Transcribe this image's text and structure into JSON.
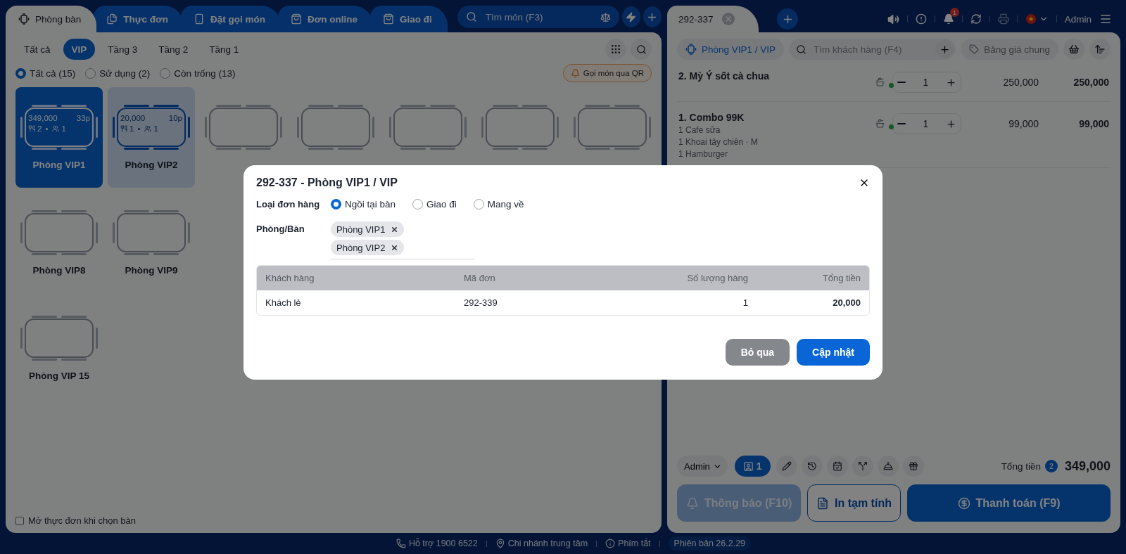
{
  "left_tabs": [
    {
      "label": "Phòng bàn",
      "selected": true
    },
    {
      "label": "Thực đơn",
      "selected": false
    },
    {
      "label": "Đặt gọi món",
      "selected": false
    },
    {
      "label": "Đơn online",
      "selected": false
    },
    {
      "label": "Giao đi",
      "selected": false
    }
  ],
  "dish_search": {
    "placeholder": "Tìm món (F3)"
  },
  "area_filters": [
    {
      "label": "Tất cả",
      "selected": false
    },
    {
      "label": "VIP",
      "selected": true
    },
    {
      "label": "Tầng 3",
      "selected": false
    },
    {
      "label": "Tầng 2",
      "selected": false
    },
    {
      "label": "Tầng 1",
      "selected": false
    }
  ],
  "status_filters": [
    {
      "label": "Tất cả (15)",
      "selected": true
    },
    {
      "label": "Sử dụng (2)",
      "selected": false
    },
    {
      "label": "Còn trống (13)",
      "selected": false
    }
  ],
  "qr_button": "Gọi món qua QR",
  "table_rows": [
    [
      {
        "label": "Phòng VIP1",
        "selected": true,
        "occupied": true,
        "amount": "349,000",
        "duration": "33p",
        "dishes": "2",
        "guests": "1"
      },
      {
        "label": "Phòng VIP2",
        "selected": false,
        "occupied": true,
        "amount": "20,000",
        "duration": "10p",
        "dishes": "1",
        "guests": "1"
      },
      {
        "selected": false,
        "occupied": false
      },
      {
        "selected": false,
        "occupied": false
      },
      {
        "selected": false,
        "occupied": false
      },
      {
        "selected": false,
        "occupied": false
      },
      {
        "selected": false,
        "occupied": false
      }
    ],
    [
      {
        "label": "Phòng VIP8",
        "selected": false,
        "occupied": false
      },
      {
        "label": "Phòng VIP9",
        "selected": false,
        "occupied": false
      }
    ],
    [
      {
        "label": "Phòng VIP 15",
        "selected": false,
        "occupied": false
      }
    ]
  ],
  "open_menu_option": {
    "label": "Mở thực đơn khi chọn bàn",
    "checked": false
  },
  "order": {
    "tab": "292-337",
    "location": "Phòng VIP1 / VIP",
    "customer_search": {
      "placeholder": "Tìm khách hàng (F4)"
    },
    "price_list": "Bảng giá chung",
    "items": [
      {
        "name": "2. Mỳ Ý sốt cà chua",
        "quantity": "1",
        "price": "250,000",
        "total": "250,000"
      },
      {
        "name": "1. Combo 99K",
        "parts": [
          "1 Cafe sữa",
          "1 Khoai tây chiên ·  M",
          "1 Hamburger"
        ],
        "quantity": "1",
        "price": "99,000",
        "total": "99,000"
      }
    ],
    "staff": "Admin",
    "guest_count": "1",
    "total_label": "Tổng tiền",
    "item_count": "2",
    "total": "349,000",
    "actions": [
      {
        "label": "Thông báo (F10)",
        "kind": "notify"
      },
      {
        "label": "In tạm tính",
        "kind": "print"
      },
      {
        "label": "Thanh toán (F9)",
        "kind": "pay"
      }
    ]
  },
  "header": {
    "notification_count": "1",
    "user": "Admin"
  },
  "footer": [
    "Hỗ trợ 1900 6522",
    "Chi nhánh trung tâm",
    "Phím tắt",
    "Phiên bản 26.2.29"
  ],
  "dialog": {
    "title": "292-337 - Phòng VIP1 / VIP",
    "order_type_label": "Loại đơn hàng",
    "order_types": [
      {
        "label": "Ngồi tại bàn",
        "selected": true
      },
      {
        "label": "Giao đi",
        "selected": false
      },
      {
        "label": "Mang về",
        "selected": false
      }
    ],
    "rooms_label": "Phòng/Bàn",
    "rooms": [
      "Phòng VIP1",
      "Phòng VIP2"
    ],
    "columns": [
      "Khách hàng",
      "Mã đơn",
      "Số lượng hàng",
      "Tổng tiền"
    ],
    "rows": [
      [
        "Khách lẻ",
        "292-339",
        "1",
        "20,000"
      ]
    ],
    "buttons": [
      {
        "label": "Bỏ qua",
        "kind": "cancel"
      },
      {
        "label": "Cập nhật",
        "kind": "primary"
      }
    ]
  }
}
